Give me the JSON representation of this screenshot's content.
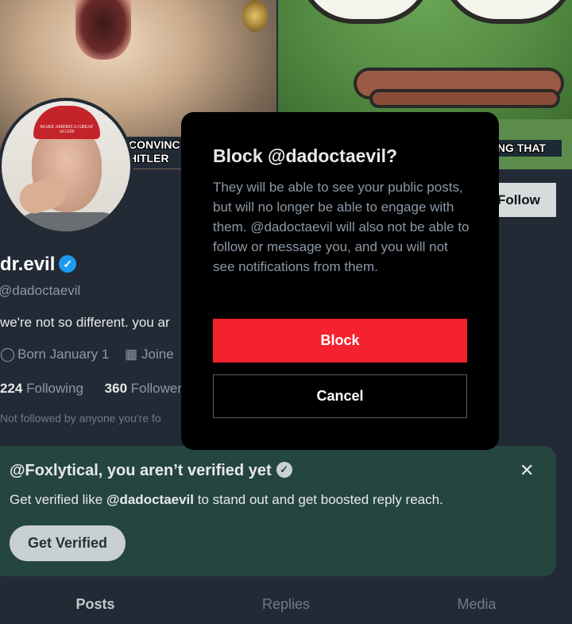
{
  "banner": {
    "left_caption": "CONVINC\nHITLER",
    "right_caption": "ING THAT"
  },
  "avatar": {
    "hat_text": "MAKE AMERICA GREAT AGAIN"
  },
  "profile": {
    "follow_label": "Follow",
    "display_name": "dr.evil",
    "handle": "@dadoctaevil",
    "bio": "we're not so different. you ar",
    "born": "Born January 1",
    "joined": "Joine",
    "following_count": "224",
    "following_label": "Following",
    "followers_count": "360",
    "followers_label": "Followers",
    "not_followed": "Not followed by anyone you're fo"
  },
  "verify_card": {
    "title": "@Foxlytical, you aren’t verified yet",
    "text_prefix": "Get verified like ",
    "text_handle": "@dadoctaevil",
    "text_suffix": " to stand out and get boosted reply reach.",
    "button": "Get Verified",
    "close": "✕"
  },
  "tabs": [
    {
      "label": "Posts",
      "active": true
    },
    {
      "label": "Replies",
      "active": false
    },
    {
      "label": "Media",
      "active": false
    }
  ],
  "modal": {
    "title": "Block @dadoctaevil?",
    "body": "They will be able to see your public posts, but will no longer be able to engage with them. @dadoctaevil will also not be able to follow or message you, and you will not see notifications from them.",
    "block_label": "Block",
    "cancel_label": "Cancel"
  },
  "colors": {
    "block_red": "#f4212e",
    "verified_blue": "#1d9bf0",
    "page_bg": "#222b35",
    "verify_card_bg": "#25453f"
  },
  "icons": [
    "verified-badge-icon",
    "balloon-icon",
    "calendar-icon",
    "close-icon",
    "verified-check-icon"
  ]
}
